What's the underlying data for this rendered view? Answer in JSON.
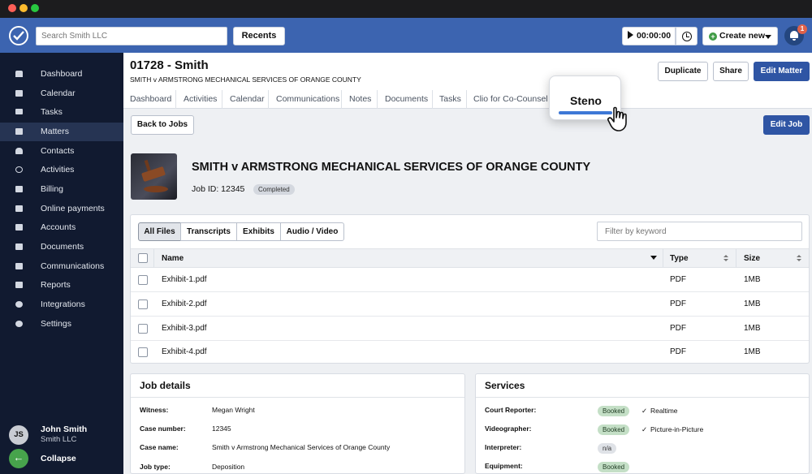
{
  "topbar": {
    "search_placeholder": "Search Smith LLC",
    "recents_label": "Recents",
    "timer_value": "00:00:00",
    "create_label": "Create new",
    "notification_count": "1"
  },
  "sidebar": {
    "items": [
      {
        "label": "Dashboard",
        "icon": "home-icon"
      },
      {
        "label": "Calendar",
        "icon": "calendar-icon"
      },
      {
        "label": "Tasks",
        "icon": "tasks-icon"
      },
      {
        "label": "Matters",
        "icon": "briefcase-icon"
      },
      {
        "label": "Contacts",
        "icon": "contacts-icon"
      },
      {
        "label": "Activities",
        "icon": "clock-icon"
      },
      {
        "label": "Billing",
        "icon": "billing-icon"
      },
      {
        "label": "Online payments",
        "icon": "card-icon"
      },
      {
        "label": "Accounts",
        "icon": "bank-icon"
      },
      {
        "label": "Documents",
        "icon": "folder-icon"
      },
      {
        "label": "Communications",
        "icon": "phone-icon"
      },
      {
        "label": "Reports",
        "icon": "chart-icon"
      },
      {
        "label": "Integrations",
        "icon": "sync-icon"
      },
      {
        "label": "Settings",
        "icon": "gear-icon"
      }
    ],
    "active_item": "Matters",
    "user": {
      "initials": "JS",
      "name": "John Smith",
      "firm": "Smith LLC"
    },
    "collapse_label": "Collapse"
  },
  "matter": {
    "title": "01728 - Smith",
    "subtitle": "SMITH v ARMSTRONG MECHANICAL SERVICES OF ORANGE COUNTY",
    "buttons": {
      "duplicate": "Duplicate",
      "share": "Share",
      "edit": "Edit Matter"
    },
    "tabs": [
      "Dashboard",
      "Activities",
      "Calendar",
      "Communications",
      "Notes",
      "Documents",
      "Tasks",
      "Clio for Co-Counsel"
    ],
    "highlight_tab": "Steno"
  },
  "job": {
    "back_label": "Back to Jobs",
    "edit_label": "Edit Job",
    "title": "SMITH v ARMSTRONG MECHANICAL SERVICES OF ORANGE COUNTY",
    "id_text": "Job ID: 12345",
    "status": "Completed"
  },
  "files": {
    "filters": [
      "All Files",
      "Transcripts",
      "Exhibits",
      "Audio / Video"
    ],
    "active_filter": "All Files",
    "search_placeholder": "Filter by keyword",
    "columns": [
      "Name",
      "Type",
      "Size"
    ],
    "rows": [
      {
        "name": "Exhibit-1.pdf",
        "type": "PDF",
        "size": "1MB"
      },
      {
        "name": "Exhibit-2.pdf",
        "type": "PDF",
        "size": "1MB"
      },
      {
        "name": "Exhibit-3.pdf",
        "type": "PDF",
        "size": "1MB"
      },
      {
        "name": "Exhibit-4.pdf",
        "type": "PDF",
        "size": "1MB"
      }
    ]
  },
  "job_details": {
    "title": "Job details",
    "rows": [
      {
        "label": "Witness:",
        "value": "Megan Wright"
      },
      {
        "label": "Case number:",
        "value": "12345"
      },
      {
        "label": "Case name:",
        "value": "Smith v Armstrong Mechanical Services of Orange County"
      },
      {
        "label": "Job type:",
        "value": "Deposition"
      }
    ]
  },
  "services": {
    "title": "Services",
    "rows": [
      {
        "label": "Court Reporter:",
        "status": "Booked",
        "extra": "Realtime"
      },
      {
        "label": "Videographer:",
        "status": "Booked",
        "extra": "Picture-in-Picture"
      },
      {
        "label": "Interpreter:",
        "status": "n/a",
        "extra": ""
      },
      {
        "label": "Equipment:",
        "status": "Booked",
        "extra": ""
      }
    ]
  },
  "colors": {
    "topbar": "#3c64b0",
    "sidebar": "#111a30",
    "primary_button": "#2f55a4",
    "booked_pill": "#c4dfc6",
    "collapse": "#47a34c"
  }
}
